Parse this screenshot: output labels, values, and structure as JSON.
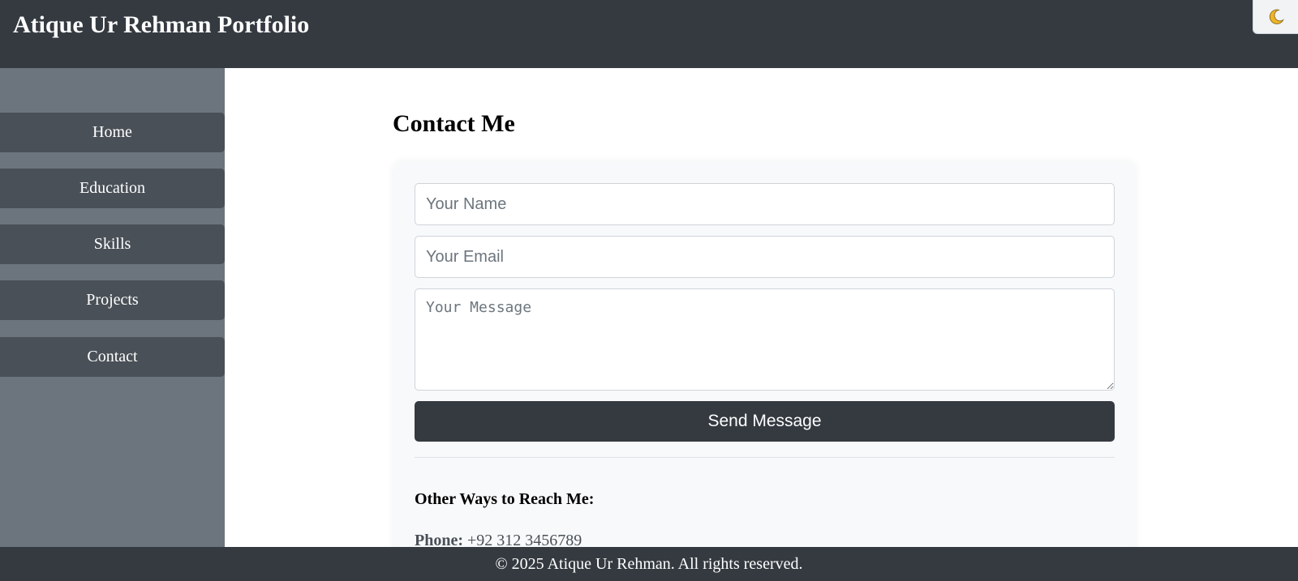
{
  "header": {
    "title": "Atique Ur Rehman Portfolio",
    "theme_toggle_icon": "moon-icon",
    "theme_toggle_color": "#f0b429"
  },
  "sidebar": {
    "items": [
      {
        "label": "Home"
      },
      {
        "label": "Education"
      },
      {
        "label": "Skills"
      },
      {
        "label": "Projects"
      },
      {
        "label": "Contact"
      }
    ]
  },
  "contact": {
    "heading": "Contact Me",
    "name_placeholder": "Your Name",
    "email_placeholder": "Your Email",
    "message_placeholder": "Your Message",
    "send_label": "Send Message",
    "other_heading": "Other Ways to Reach Me:",
    "phone_label": "Phone:",
    "phone_value": "+92 312 3456789"
  },
  "footer": {
    "text": "© 2025 Atique Ur Rehman. All rights reserved."
  },
  "colors": {
    "header_bg": "#343a40",
    "sidebar_bg": "#6c757d",
    "nav_button_bg": "#495057",
    "card_bg": "#f8f9fa",
    "button_bg": "#343a40"
  }
}
